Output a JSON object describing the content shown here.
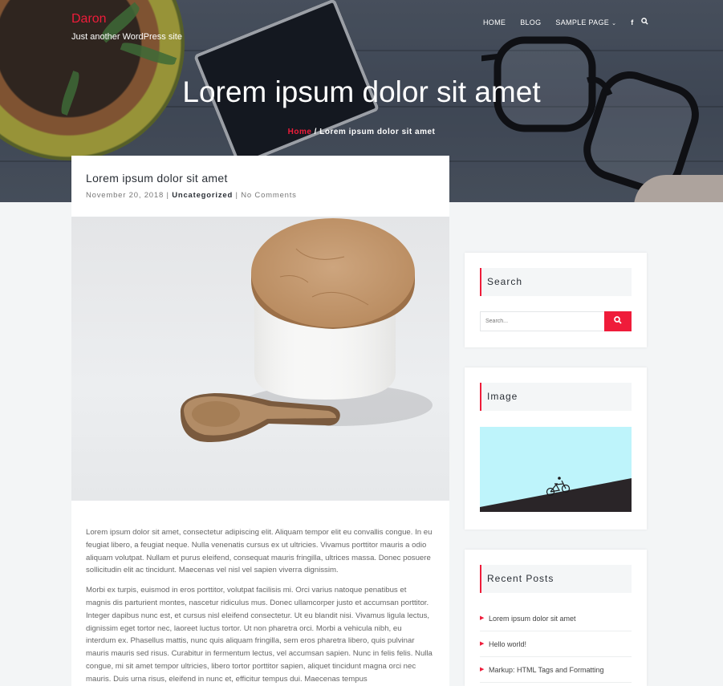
{
  "site": {
    "title": "Daron",
    "tagline": "Just another WordPress site"
  },
  "nav": {
    "items": [
      "HOME",
      "BLOG",
      "SAMPLE PAGE"
    ],
    "facebook_icon": "f",
    "search_icon": "search-icon"
  },
  "hero": {
    "title": "Lorem ipsum dolor sit amet",
    "breadcrumb_home": "Home",
    "breadcrumb_sep": " / ",
    "breadcrumb_current": "Lorem ipsum dolor sit amet"
  },
  "post": {
    "title": "Lorem ipsum dolor sit amet",
    "date": "November 20, 2018",
    "sep": " | ",
    "category": "Uncategorized",
    "comments": "No Comments",
    "paragraphs": [
      "Lorem ipsum dolor sit amet, consectetur adipiscing elit. Aliquam tempor elit eu convallis congue. In eu feugiat libero, a feugiat neque. Nulla venenatis cursus ex ut ultricies. Vivamus porttitor mauris a odio aliquam volutpat. Nullam et purus eleifend, consequat mauris fringilla, ultrices massa. Donec posuere sollicitudin elit ac tincidunt. Maecenas vel nisl vel sapien viverra dignissim.",
      "Morbi ex turpis, euismod in eros porttitor, volutpat facilisis mi. Orci varius natoque penatibus et magnis dis parturient montes, nascetur ridiculus mus. Donec ullamcorper justo et accumsan porttitor. Integer dapibus nunc est, et cursus nisl eleifend consectetur. Ut eu blandit nisi. Vivamus ligula lectus, dignissim eget tortor nec, laoreet luctus tortor. Ut non pharetra orci. Morbi a vehicula nibh, eu interdum ex. Phasellus mattis, nunc quis aliquam fringilla, sem eros pharetra libero, quis pulvinar mauris mauris sed risus. Curabitur in fermentum lectus, vel accumsan sapien. Nunc in felis felis. Nulla congue, mi sit amet tempor ultricies, libero tortor porttitor sapien, aliquet tincidunt magna orci nec mauris. Duis urna risus, eleifend in nunc et, efficitur tempus dui. Maecenas tempus"
    ]
  },
  "sidebar": {
    "search": {
      "title": "Search",
      "placeholder": "Search..."
    },
    "image": {
      "title": "Image"
    },
    "recent": {
      "title": "Recent Posts",
      "items": [
        "Lorem ipsum dolor sit amet",
        "Hello world!",
        "Markup: HTML Tags and Formatting"
      ]
    }
  },
  "colors": {
    "accent": "#ef1c3a",
    "background": "#f3f5f6",
    "widget_title_bg": "#f4f6f7",
    "image_sky": "#bef4fb"
  }
}
